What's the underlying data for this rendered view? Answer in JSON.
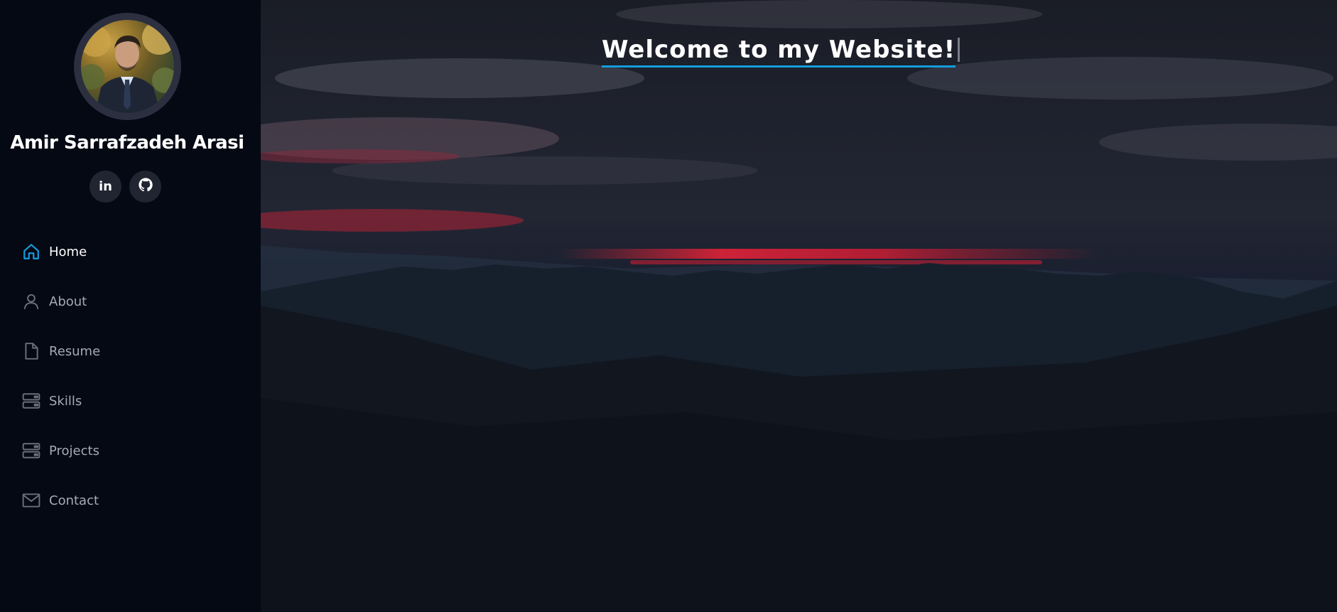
{
  "profile": {
    "name": "Amir Sarrafzadeh Arasi",
    "avatar_alt": "profile-photo"
  },
  "social": [
    {
      "name": "linkedin",
      "label": "in",
      "icon": "linkedin-icon"
    },
    {
      "name": "github",
      "label": "",
      "icon": "github-icon"
    }
  ],
  "nav": {
    "items": [
      {
        "label": "Home",
        "icon": "home-icon",
        "active": true
      },
      {
        "label": "About",
        "icon": "user-icon",
        "active": false
      },
      {
        "label": "Resume",
        "icon": "file-icon",
        "active": false
      },
      {
        "label": "Skills",
        "icon": "server-icon",
        "active": false
      },
      {
        "label": "Projects",
        "icon": "server-icon",
        "active": false
      },
      {
        "label": "Contact",
        "icon": "envelope-icon",
        "active": false
      }
    ]
  },
  "hero": {
    "title": "Welcome to my Website!"
  },
  "colors": {
    "accent": "#149ddd",
    "sidebar_bg": "#040914",
    "nav_text": "#a8a9b4",
    "hero_bg": "#0d0f16"
  }
}
